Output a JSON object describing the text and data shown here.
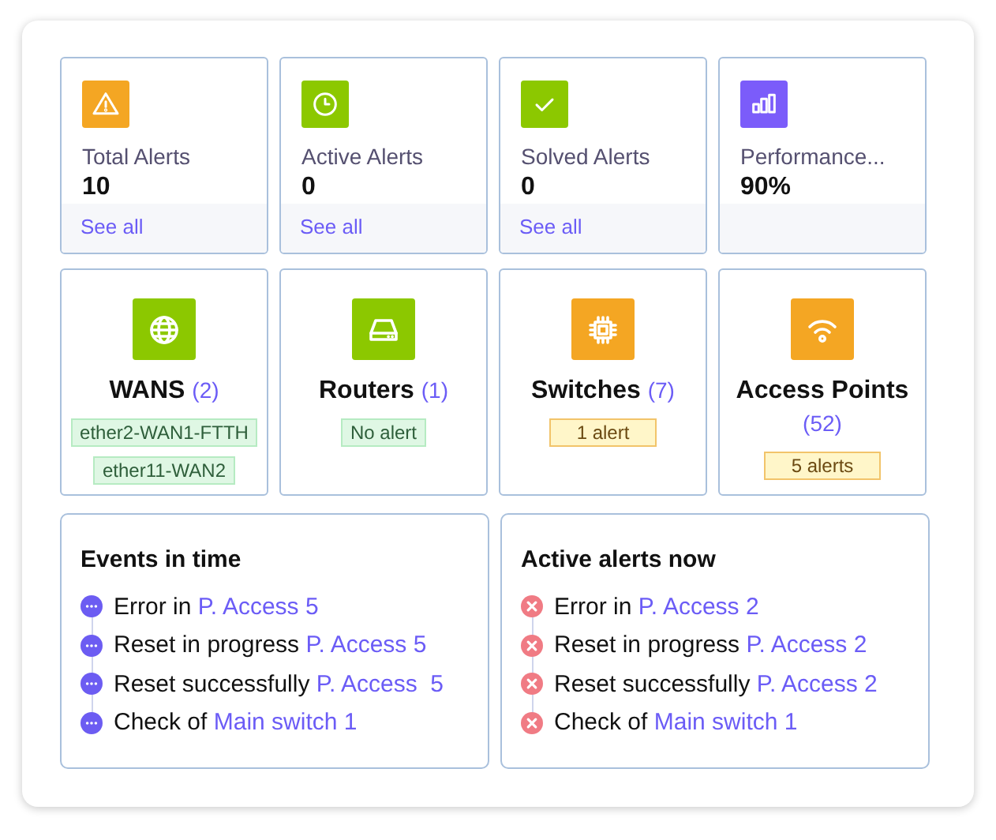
{
  "stats": [
    {
      "label": "Total Alerts",
      "value": "10",
      "color": "#f4a623",
      "link": "See all"
    },
    {
      "label": "Active Alerts",
      "value": "0",
      "color": "#8cc800",
      "link": "See all"
    },
    {
      "label": "Solved Alerts",
      "value": "0",
      "color": "#8cc800",
      "link": "See all"
    },
    {
      "label": "Performance...",
      "value": "90%",
      "color": "#7b5cfa"
    }
  ],
  "devices": [
    {
      "name": "WANS",
      "count": "(2)",
      "color": "#8cc800",
      "tags": [
        {
          "text": "ether2-WAN1-FTTH",
          "kind": "ok"
        },
        {
          "text": "ether11-WAN2",
          "kind": "ok"
        }
      ]
    },
    {
      "name": "Routers",
      "count": "(1)",
      "color": "#8cc800",
      "tags": [
        {
          "text": "No alert",
          "kind": "ok"
        }
      ]
    },
    {
      "name": "Switches",
      "count": "(7)",
      "color": "#f4a623",
      "tags": [
        {
          "text": "1 alert",
          "kind": "warn"
        }
      ]
    },
    {
      "name": "Access Points",
      "count": "(52)",
      "color": "#f4a623",
      "tags": [
        {
          "text": "5 alerts",
          "kind": "warn"
        }
      ]
    }
  ],
  "panels": [
    {
      "title": "Events in time",
      "kind": "info",
      "events": [
        {
          "text": "Error in",
          "target": "P. Access 5"
        },
        {
          "text": "Reset in progress",
          "target": "P. Access 5"
        },
        {
          "text": "Reset successfully",
          "target": "P. Access  5"
        },
        {
          "text": "Check of",
          "target": "Main switch 1"
        }
      ]
    },
    {
      "title": "Active alerts now",
      "kind": "error",
      "events": [
        {
          "text": "Error in",
          "target": "P. Access 2"
        },
        {
          "text": "Reset in progress",
          "target": "P. Access 2"
        },
        {
          "text": "Reset successfully",
          "target": "P. Access 2"
        },
        {
          "text": "Check of",
          "target": "Main switch 1"
        }
      ]
    }
  ]
}
